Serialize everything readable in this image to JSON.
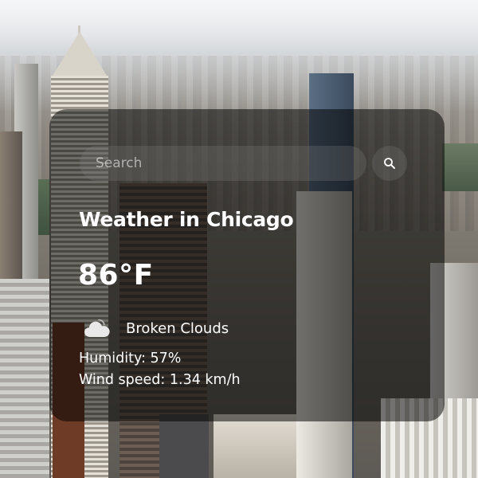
{
  "search": {
    "placeholder": "Search",
    "value": "",
    "button_icon": "search-icon"
  },
  "weather": {
    "title": "Weather in Chicago",
    "temperature": "86°F",
    "condition_icon": "cloud-icon",
    "condition": "Broken Clouds",
    "humidity": "Humidity: 57%",
    "wind": "Wind speed: 1.34 km/h"
  },
  "colors": {
    "card_background": "#000000",
    "text": "#ffffff"
  }
}
